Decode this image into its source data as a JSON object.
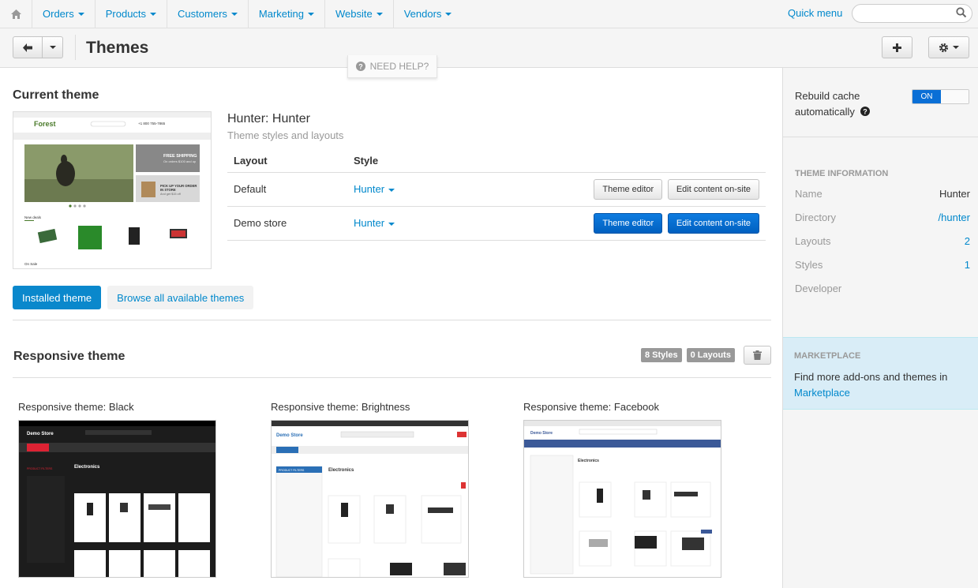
{
  "nav": {
    "items": [
      "Orders",
      "Products",
      "Customers",
      "Marketing",
      "Website",
      "Vendors"
    ],
    "quick_menu": "Quick menu",
    "search_placeholder": ""
  },
  "header": {
    "title": "Themes",
    "need_help": "NEED HELP?"
  },
  "current": {
    "section_title": "Current theme",
    "theme_name": "Hunter: Hunter",
    "theme_subtitle": "Theme styles and layouts",
    "col_layout": "Layout",
    "col_style": "Style",
    "rows": [
      {
        "layout": "Default",
        "style": "Hunter",
        "btn1": "Theme editor",
        "btn2": "Edit content on-site"
      },
      {
        "layout": "Demo store",
        "style": "Hunter",
        "btn1": "Theme editor",
        "btn2": "Edit content on-site"
      }
    ],
    "tab_installed": "Installed theme",
    "tab_browse": "Browse all available themes"
  },
  "preview_hunter": {
    "logo": "Forest",
    "phone": "+1 800 755-7865",
    "banner1_title": "FREE SHIPPING",
    "banner1_sub": "On orders $100 and up",
    "banner2_title": "PICK UP YOUR ORDER",
    "banner2_title2": "IN STORE",
    "banner2_sub": "And get $15 off",
    "new_deals": "New deals",
    "on_sale": "On Sale"
  },
  "responsive": {
    "section_title": "Responsive theme",
    "styles_badge": "8 Styles",
    "layouts_badge": "0 Layouts",
    "styles": [
      {
        "name": "Responsive theme: Black"
      },
      {
        "name": "Responsive theme: Brightness"
      },
      {
        "name": "Responsive theme: Facebook"
      }
    ],
    "preview_logo": "Demo Store",
    "preview_heading": "Electronics",
    "preview_filters": "PRODUCT FILTERS"
  },
  "sidebar": {
    "rebuild_label": "Rebuild cache automatically",
    "toggle_on": "ON",
    "info_header": "THEME INFORMATION",
    "info": [
      {
        "label": "Name",
        "value": "Hunter"
      },
      {
        "label": "Directory",
        "value": "/hunter"
      },
      {
        "label": "Layouts",
        "value": "2"
      },
      {
        "label": "Styles",
        "value": "1"
      },
      {
        "label": "Developer",
        "value": ""
      }
    ],
    "marketplace_header": "MARKETPLACE",
    "marketplace_text": "Find more add-ons and themes in",
    "marketplace_link": "Marketplace"
  }
}
